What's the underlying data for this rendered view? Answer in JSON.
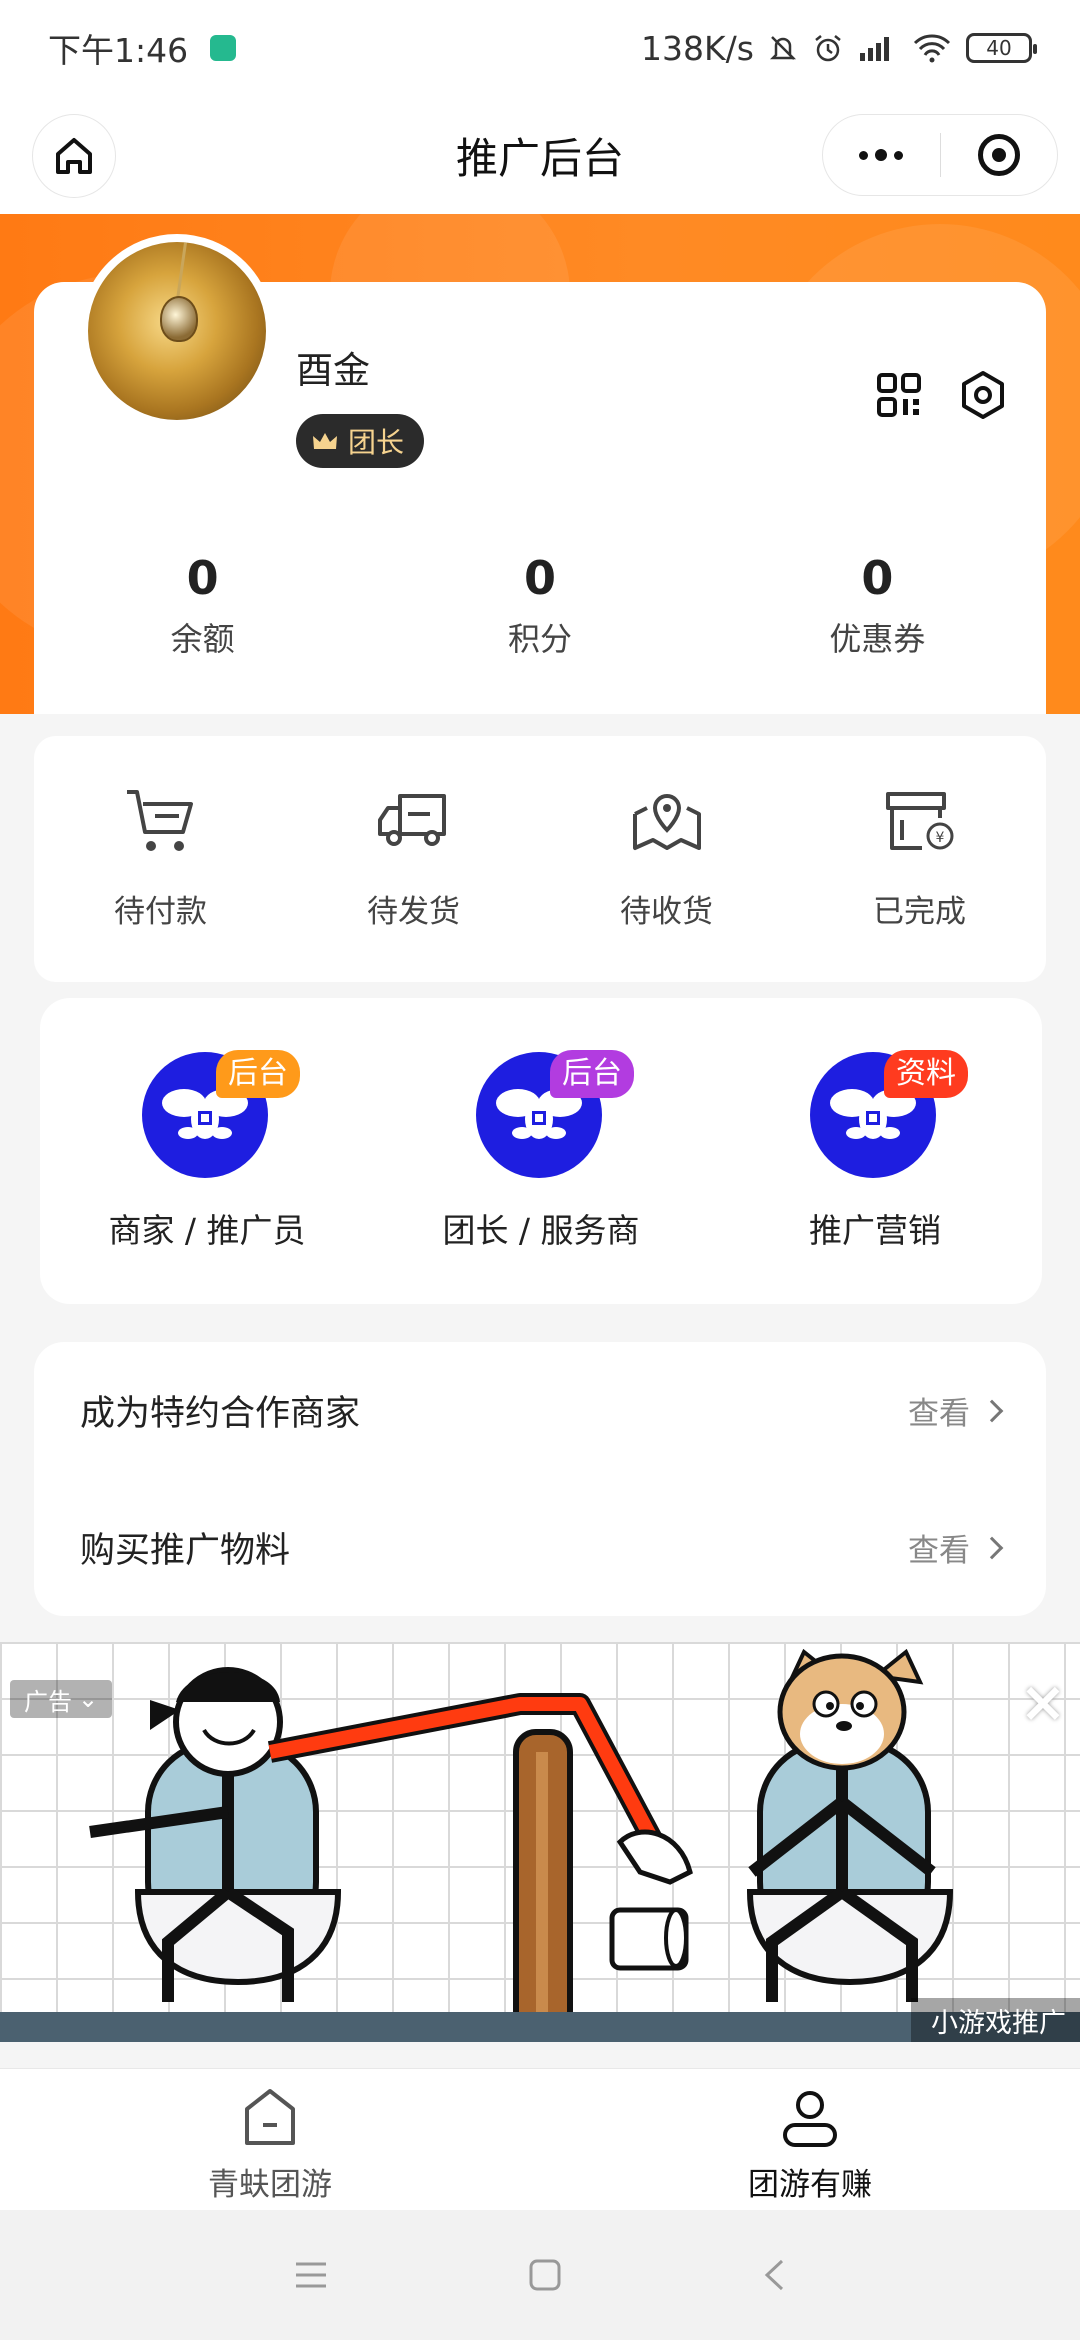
{
  "status_bar": {
    "time": "下午1:46",
    "network_speed": "138K/s",
    "battery": "40"
  },
  "nav": {
    "title": "推广后台"
  },
  "profile": {
    "name": "酉金",
    "role": "团长"
  },
  "stats": [
    {
      "value": "0",
      "label": "余额"
    },
    {
      "value": "0",
      "label": "积分"
    },
    {
      "value": "0",
      "label": "优惠券"
    }
  ],
  "orders": [
    {
      "label": "待付款",
      "icon": "cart-icon"
    },
    {
      "label": "待发货",
      "icon": "truck-icon"
    },
    {
      "label": "待收货",
      "icon": "map-pin-icon"
    },
    {
      "label": "已完成",
      "icon": "completed-box-icon"
    }
  ],
  "backends": [
    {
      "label": "商家 / 推广员",
      "tag": "后台",
      "tag_color": "#ff9a1a"
    },
    {
      "label": "团长 / 服务商",
      "tag": "后台",
      "tag_color": "#b23ce0"
    },
    {
      "label": "推广营销",
      "tag": "资料",
      "tag_color": "#ff3b1f"
    }
  ],
  "links": [
    {
      "title": "成为特约合作商家",
      "action": "查看"
    },
    {
      "title": "购买推广物料",
      "action": "查看"
    }
  ],
  "ad": {
    "label": "广告",
    "source": "小游戏推广"
  },
  "tabbar": [
    {
      "label": "青蚨团游",
      "icon": "home-tab-icon"
    },
    {
      "label": "团游有赚",
      "icon": "user-tab-icon"
    }
  ]
}
